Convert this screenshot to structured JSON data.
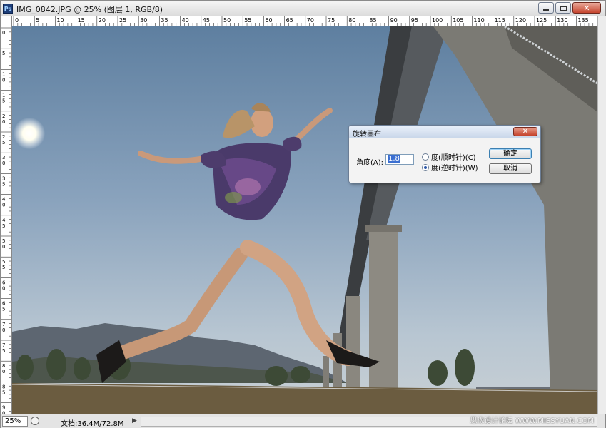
{
  "window": {
    "app_icon": "Ps",
    "title": "IMG_0842.JPG @ 25% (图层 1, RGB/8)"
  },
  "rulers": {
    "top_labels": [
      "0",
      "5",
      "10",
      "15",
      "20",
      "25",
      "30",
      "35",
      "40",
      "45",
      "50",
      "55",
      "60",
      "65",
      "70",
      "75",
      "80",
      "85",
      "90",
      "95",
      "100",
      "105",
      "110",
      "115",
      "120",
      "125",
      "130",
      "135"
    ],
    "left_labels": [
      "0",
      "5",
      "1 0",
      "1 5",
      "2 0",
      "2 5",
      "3 0",
      "3 5",
      "4 0",
      "4 5",
      "5 0",
      "5 5",
      "6 0",
      "6 5",
      "7 0",
      "7 5",
      "8 0",
      "8 5",
      "9 0"
    ]
  },
  "dialog": {
    "title": "旋转画布",
    "close_glyph": "✕",
    "angle_label": "角度(A):",
    "angle_value": "1.8",
    "radio_cw": "度(顺时针)(C)",
    "radio_ccw": "度(逆时针)(W)",
    "selected": "ccw",
    "ok_label": "确定",
    "cancel_label": "取消"
  },
  "status": {
    "zoom": "25%",
    "doc": "文档:36.4M/72.8M",
    "arrow": "▶"
  },
  "watermark": "思缘设计论坛 WWW.MISSYUAN.COM",
  "colors": {
    "sky": "#7c97b3",
    "dialog_bg": "#f3f3f3",
    "close_red": "#c5432c",
    "selection_blue": "#3b6fd1"
  }
}
